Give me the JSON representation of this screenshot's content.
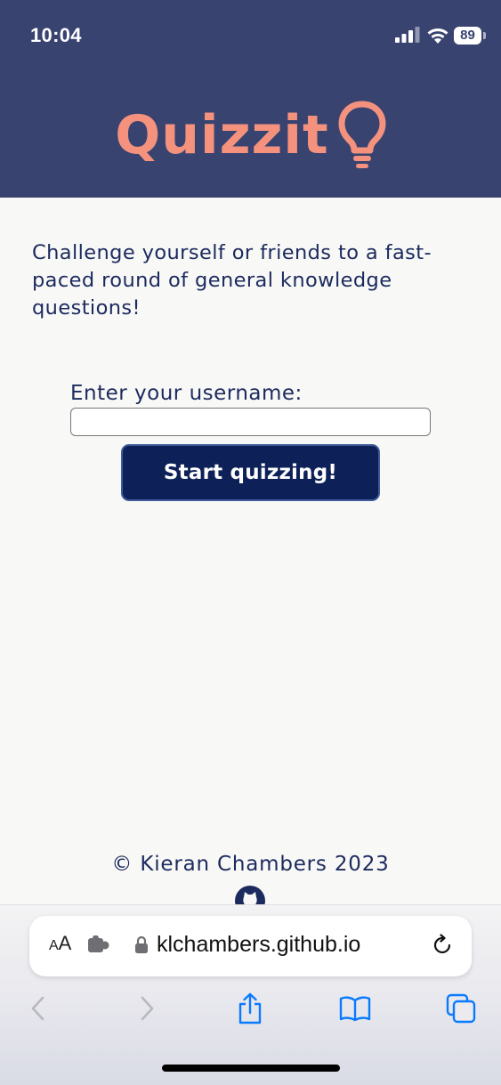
{
  "status_bar": {
    "time": "10:04",
    "battery_level": "89",
    "signal_icon": "cellular-signal-icon",
    "wifi_icon": "wifi-icon"
  },
  "app": {
    "logo_text": "Quizzit",
    "logo_icon": "lightbulb-icon",
    "intro": "Challenge yourself or friends to a fast-paced round of general knowledge questions!",
    "username_label": "Enter your username:",
    "username_value": "",
    "start_button_label": "Start quizzing!",
    "footer_copyright": "© Kieran Chambers 2023",
    "footer_icon": "github-icon"
  },
  "browser": {
    "text_size_label_small": "A",
    "text_size_label_large": "A",
    "url": "klchambers.github.io",
    "toolbar_icons": [
      "back-icon",
      "forward-icon",
      "share-icon",
      "bookmarks-icon",
      "tabs-icon"
    ]
  },
  "colors": {
    "header_bg": "#384370",
    "logo": "#f4927e",
    "text": "#1c2a5e",
    "button_bg": "#0d2057",
    "page_bg": "#f8f8f6",
    "ios_blue": "#0a7aff"
  }
}
